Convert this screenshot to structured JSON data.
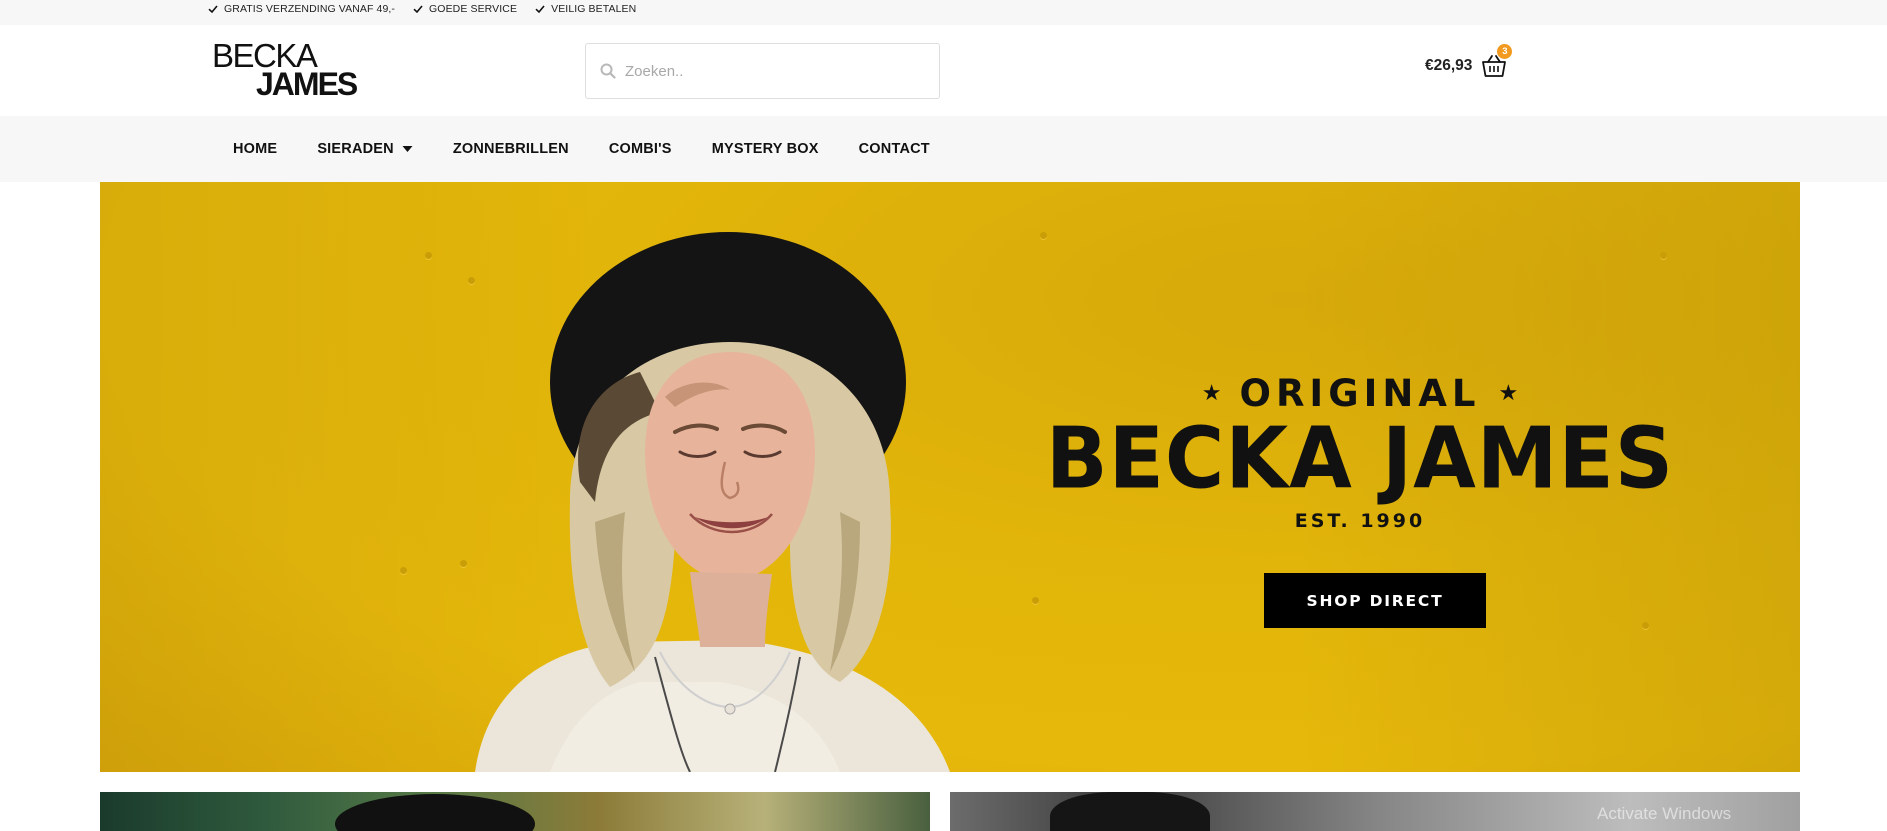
{
  "topbar": {
    "items": [
      {
        "icon": "check-icon",
        "label": "GRATIS VERZENDING VANAF 49,-"
      },
      {
        "icon": "check-icon",
        "label": "GOEDE SERVICE"
      },
      {
        "icon": "check-icon",
        "label": "VEILIG BETALEN"
      }
    ]
  },
  "header": {
    "logo_top": "BECKA",
    "logo_bottom": "JAMES",
    "search": {
      "placeholder": "Zoeken..",
      "icon": "search-icon"
    },
    "cart": {
      "total": "€26,93",
      "count": "3",
      "icon": "basket-icon",
      "badge_color": "#f29a1f"
    }
  },
  "nav": {
    "items": [
      {
        "label": "HOME"
      },
      {
        "label": "SIERADEN",
        "dropdown": true
      },
      {
        "label": "ZONNEBRILLEN"
      },
      {
        "label": "COMBI'S"
      },
      {
        "label": "MYSTERY BOX"
      },
      {
        "label": "CONTACT"
      }
    ]
  },
  "hero": {
    "original": "ORIGINAL",
    "brand": "BECKA JAMES",
    "est": "EST. 1990",
    "cta": "SHOP DIRECT",
    "background_color": "#e2b50a"
  },
  "watermark": "Activate Windows"
}
